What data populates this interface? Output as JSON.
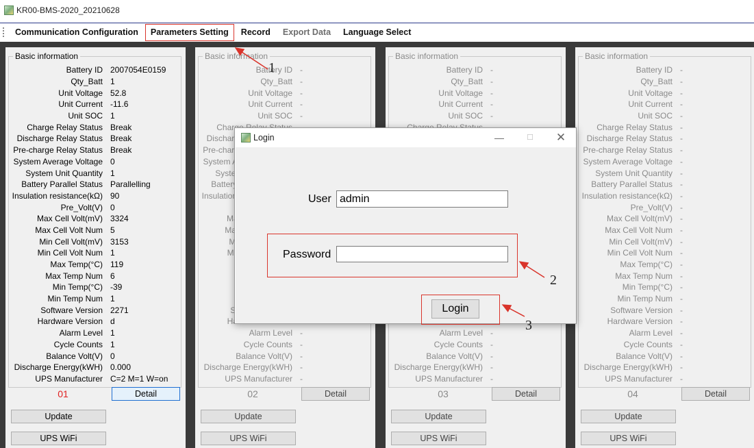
{
  "window": {
    "title": "KR00-BMS-2020_20210628"
  },
  "menu": {
    "items": [
      {
        "label": "Communication Configuration",
        "disabled": false,
        "highlight": false
      },
      {
        "label": "Parameters Setting",
        "disabled": false,
        "highlight": true
      },
      {
        "label": "Record",
        "disabled": false,
        "highlight": false
      },
      {
        "label": "Export Data",
        "disabled": true,
        "highlight": false
      },
      {
        "label": "Language Select",
        "disabled": false,
        "highlight": false
      }
    ]
  },
  "labels": [
    "Battery ID",
    "Qty_Batt",
    "Unit Voltage",
    "Unit Current",
    "Unit SOC",
    "Charge Relay Status",
    "Discharge Relay Status",
    "Pre-charge Relay Status",
    "System Average Voltage",
    "System Unit Quantity",
    "Battery Parallel Status",
    "Insulation resistance(kΩ)",
    "Pre_Volt(V)",
    "Max Cell Volt(mV)",
    "Max Cell Volt Num",
    "Min Cell Volt(mV)",
    "Min Cell Volt Num",
    "Max Temp(°C)",
    "Max Temp Num",
    "Min Temp(°C)",
    "Min Temp Num",
    "Software Version",
    "Hardware Version",
    "Alarm Level",
    "Cycle Counts",
    "Balance Volt(V)",
    "Discharge Energy(kWH)",
    "UPS Manufacturer"
  ],
  "panels": [
    {
      "group_title": "Basic information",
      "number": "01",
      "active": true,
      "values": [
        "2007054E0159",
        "1",
        "52.8",
        "-11.6",
        "1",
        "Break",
        "Break",
        "Break",
        "0",
        "1",
        "Parallelling",
        "90",
        "0",
        "3324",
        "5",
        "3153",
        "1",
        "119",
        "6",
        "-39",
        "1",
        "2271",
        "d",
        "1",
        "1",
        "0",
        "0.000",
        "C=2 M=1 W=on"
      ],
      "detail_label": "Detail",
      "update_label": "Update",
      "wifi_label": "UPS  WiFi"
    },
    {
      "group_title": "Basic information",
      "number": "02",
      "active": false,
      "values": [
        "-",
        "-",
        "-",
        "-",
        "-",
        "-",
        "-",
        "-",
        "-",
        "-",
        "-",
        "-",
        "-",
        "-",
        "-",
        "-",
        "-",
        "-",
        "-",
        "-",
        "-",
        "-",
        "-",
        "-",
        "-",
        "-",
        "-",
        "-"
      ],
      "detail_label": "Detail",
      "update_label": "Update",
      "wifi_label": "UPS  WiFi"
    },
    {
      "group_title": "Basic information",
      "number": "03",
      "active": false,
      "values": [
        "-",
        "-",
        "-",
        "-",
        "-",
        "-",
        "-",
        "-",
        "-",
        "-",
        "-",
        "-",
        "-",
        "-",
        "-",
        "-",
        "-",
        "-",
        "-",
        "-",
        "-",
        "-",
        "-",
        "-",
        "-",
        "-",
        "-",
        "-"
      ],
      "detail_label": "Detail",
      "update_label": "Update",
      "wifi_label": "UPS  WiFi"
    },
    {
      "group_title": "Basic information",
      "number": "04",
      "active": false,
      "values": [
        "-",
        "-",
        "-",
        "-",
        "-",
        "-",
        "-",
        "-",
        "-",
        "-",
        "-",
        "-",
        "-",
        "-",
        "-",
        "-",
        "-",
        "-",
        "-",
        "-",
        "-",
        "-",
        "-",
        "-",
        "-",
        "-",
        "-",
        "-"
      ],
      "detail_label": "Detail",
      "update_label": "Update",
      "wifi_label": "UPS  WiFi"
    }
  ],
  "login": {
    "title": "Login",
    "user_label": "User",
    "user_value": "admin",
    "password_label": "Password",
    "password_value": "",
    "login_button": "Login"
  },
  "annotations": [
    "1",
    "2",
    "3"
  ],
  "colors": {
    "highlight": "#d9342b",
    "active_number": "#e02020",
    "background": "#3a3a3a",
    "panel": "#f0f0f0"
  }
}
